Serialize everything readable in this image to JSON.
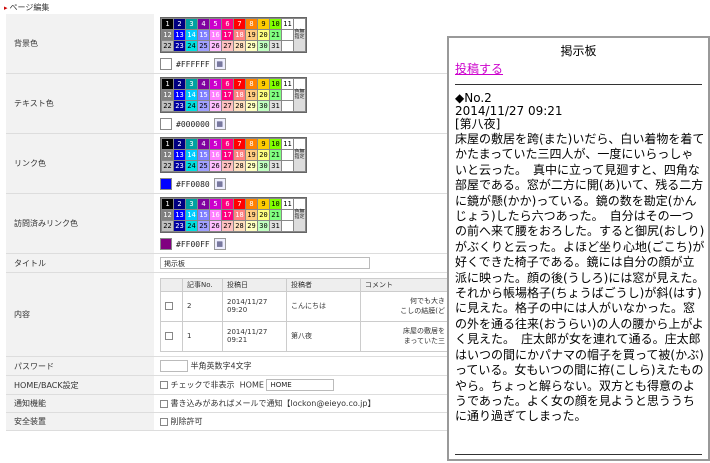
{
  "section_title": "ページ編集",
  "palette": [
    {
      "n": "1",
      "c": "#000000",
      "d": false
    },
    {
      "n": "2",
      "c": "#000080",
      "d": false
    },
    {
      "n": "3",
      "c": "#00a0a0",
      "d": false
    },
    {
      "n": "4",
      "c": "#8000a0",
      "d": false
    },
    {
      "n": "5",
      "c": "#cc00cc",
      "d": false
    },
    {
      "n": "6",
      "c": "#ff0080",
      "d": false
    },
    {
      "n": "7",
      "c": "#ff0000",
      "d": false
    },
    {
      "n": "8",
      "c": "#ff8000",
      "d": false
    },
    {
      "n": "9",
      "c": "#ffcc00",
      "d": true
    },
    {
      "n": "10",
      "c": "#80ff00",
      "d": true
    },
    {
      "n": "11",
      "c": "#ffffff",
      "d": true
    },
    {
      "n": "",
      "c": "#ffffff",
      "d": true
    },
    {
      "n": "12",
      "c": "#808080",
      "d": false
    },
    {
      "n": "13",
      "c": "#0000ff",
      "d": false
    },
    {
      "n": "14",
      "c": "#00ccff",
      "d": false
    },
    {
      "n": "15",
      "c": "#8080ff",
      "d": false
    },
    {
      "n": "16",
      "c": "#ff80ff",
      "d": false
    },
    {
      "n": "17",
      "c": "#ff0080",
      "d": false
    },
    {
      "n": "18",
      "c": "#ff8080",
      "d": false
    },
    {
      "n": "19",
      "c": "#ffcc80",
      "d": true
    },
    {
      "n": "20",
      "c": "#ffff80",
      "d": true
    },
    {
      "n": "21",
      "c": "#80ff80",
      "d": true
    },
    {
      "n": "",
      "c": "#ffffff",
      "d": true
    },
    {
      "n": "",
      "c": "#ffffff",
      "d": true
    },
    {
      "n": "22",
      "c": "#c0c0c0",
      "d": true
    },
    {
      "n": "23",
      "c": "#0000a0",
      "d": false
    },
    {
      "n": "24",
      "c": "#00e0e0",
      "d": true
    },
    {
      "n": "25",
      "c": "#a0a0ff",
      "d": true
    },
    {
      "n": "26",
      "c": "#ffc0ff",
      "d": true
    },
    {
      "n": "27",
      "c": "#ffc0c0",
      "d": true
    },
    {
      "n": "28",
      "c": "#ffe0c0",
      "d": true
    },
    {
      "n": "29",
      "c": "#ffffc0",
      "d": true
    },
    {
      "n": "30",
      "c": "#c0ffc0",
      "d": true
    },
    {
      "n": "31",
      "c": "#e0e0e0",
      "d": true
    },
    {
      "n": "",
      "c": "#ffffff",
      "d": true
    },
    {
      "n": "",
      "c": "#ffffff",
      "d": true
    }
  ],
  "special_label": "色無指定",
  "rows": {
    "bg": {
      "label": "背景色",
      "hex": "#FFFFFF",
      "swatch": "#ffffff"
    },
    "text": {
      "label": "テキスト色",
      "hex": "#000000",
      "swatch": "#ffffff"
    },
    "link": {
      "label": "リンク色",
      "hex": "#FF0080",
      "swatch": "#0000ff"
    },
    "visited": {
      "label": "訪問済みリンク色",
      "hex": "#FF00FF",
      "swatch": "#800080"
    },
    "title": {
      "label": "タイトル",
      "value": "掲示板"
    },
    "content": {
      "label": "内容",
      "headers": [
        "",
        "記事No.",
        "投稿日",
        "投稿者",
        "コメント"
      ],
      "entries": [
        {
          "no": "2",
          "date1": "2014/11/27",
          "date2": "09:20",
          "author": "こんにちは",
          "comment1": "何でも大き",
          "comment2": "こしの結膜(ど"
        },
        {
          "no": "1",
          "date1": "2014/11/27",
          "date2": "09:21",
          "author": "第八夜",
          "comment1": "床屋の敷居を",
          "comment2": "まっていた三"
        }
      ]
    },
    "password": {
      "label": "パスワード",
      "hint": "半角英数字4文字"
    },
    "home": {
      "label": "HOME/BACK設定",
      "check_label": "チェックで非表示",
      "home_label": "HOME",
      "home_value": "HOME"
    },
    "notify": {
      "label": "通知機能",
      "text": "書き込みがあればメールで通知【lockon@eieyo.co.jp】"
    },
    "safety": {
      "label": "安全装置",
      "text": "削除許可"
    }
  },
  "popup": {
    "title": "掲示板",
    "post_link": "投稿する",
    "no": "◆No.2",
    "date": "2014/11/27 09:21",
    "subject": "[第八夜]",
    "body": "床屋の敷居を跨(また)いだら、白い着物を着てかたまっていた三四人が、一度にいらっしゃいと云った。　真中に立って見廻すと、四角な部屋である。窓が二方に開(あ)いて、残る二方に鏡が懸(かか)っている。鏡の数を勘定(かんじょう)したら六つあった。　自分はその一つの前へ来て腰をおろした。すると御尻(おしり)がぶくりと云った。よほど坐り心地(ごこち)が好くできた椅子である。鏡には自分の顔が立派に映った。顔の後(うしろ)には窓が見えた。それから帳場格子(ちょうばごうし)が斜(はす)に見えた。格子の中には人がいなかった。窓の外を通る往来(おうらい)の人の腰から上がよく見えた。　庄太郎が女を連れて通る。庄太郎はいつの間にかパナマの帽子を買って被(かぶ)っている。女もいつの間に拵(こしら)えたものやら。ちょっと解らない。双方とも得意のようであった。よく女の顔を見ようと思ううちに通り過ぎてしまった。"
  }
}
